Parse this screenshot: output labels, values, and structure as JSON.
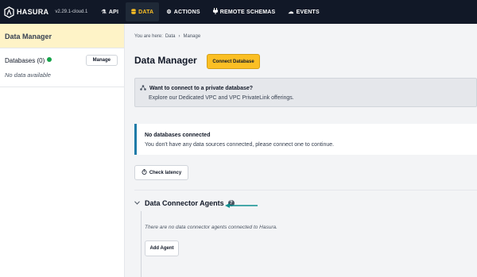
{
  "nav": {
    "brand": "HASURA",
    "version": "v2.29.1-cloud.1",
    "items": [
      {
        "label": "API",
        "icon": "flask-icon"
      },
      {
        "label": "DATA",
        "icon": "database-icon",
        "active": true
      },
      {
        "label": "ACTIONS",
        "icon": "gears-icon"
      },
      {
        "label": "REMOTE SCHEMAS",
        "icon": "plug-icon"
      },
      {
        "label": "EVENTS",
        "icon": "cloud-icon"
      }
    ]
  },
  "sidebar": {
    "header": "Data Manager",
    "databases_label": "Databases (0)",
    "manage_label": "Manage",
    "no_data": "No data available"
  },
  "main": {
    "breadcrumb": {
      "prefix": "You are here:",
      "items": [
        "Data",
        "Manage"
      ]
    },
    "title": "Data Manager",
    "connect_button": "Connect Database",
    "private_db": {
      "title": "Want to connect to a private database?",
      "subtitle": "Explore our Dedicated VPC and VPC PrivateLink offerings."
    },
    "no_db": {
      "title": "No databases connected",
      "subtitle": "You don't have any data sources connected, please connect one to continue."
    },
    "check_latency": "Check latency",
    "dca": {
      "title": "Data Connector Agents",
      "empty": "There are no data connector agents connected to Hasura.",
      "add_button": "Add Agent"
    }
  },
  "colors": {
    "nav_bg": "#111827",
    "accent": "#fbbf24",
    "info_border": "#1e7ba8",
    "arrow": "#0d8f8f",
    "status_ok": "#16a34a"
  }
}
